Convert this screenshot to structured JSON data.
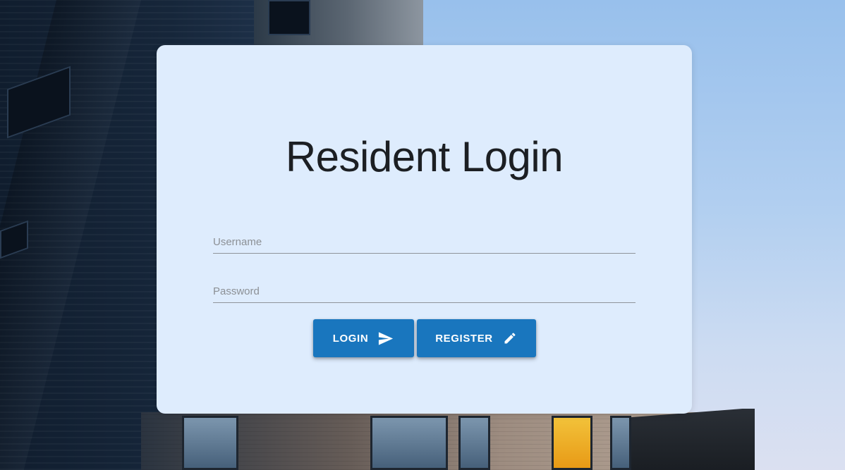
{
  "login_card": {
    "title": "Resident Login",
    "username": {
      "placeholder": "Username",
      "value": ""
    },
    "password": {
      "placeholder": "Password",
      "value": ""
    },
    "buttons": {
      "login": {
        "label": "LOGIN",
        "icon": "send-icon"
      },
      "register": {
        "label": "REGISTER",
        "icon": "pencil-icon"
      }
    }
  },
  "colors": {
    "card_background": "#deecfd",
    "button_primary": "#1976be",
    "title_text": "#1c1f23"
  }
}
